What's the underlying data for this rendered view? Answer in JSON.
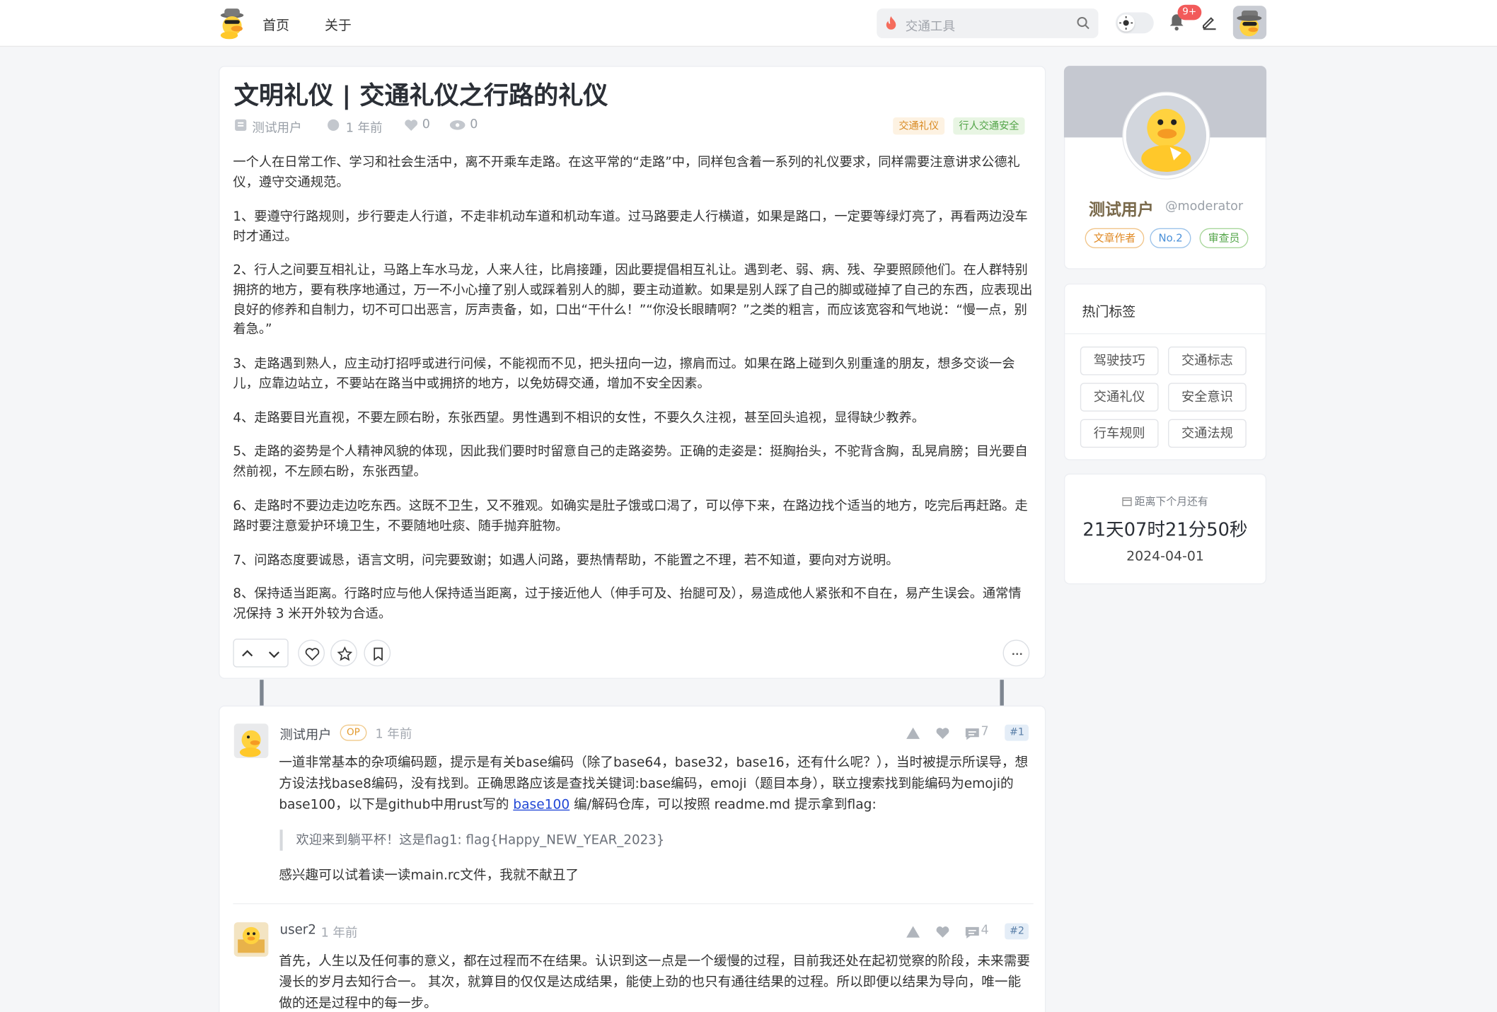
{
  "nav": {
    "home": "首页",
    "about": "关于"
  },
  "search": {
    "placeholder": "交通工具"
  },
  "notifications": {
    "badge": "9+"
  },
  "post": {
    "title": "文明礼仪 | 交通礼仪之行路的礼仪",
    "author": "测试用户",
    "time": "1 年前",
    "likes": "0",
    "views": "0",
    "tags": [
      "交通礼仪",
      "行人交通安全"
    ],
    "paragraphs": [
      "一个人在日常工作、学习和社会生活中，离不开乘车走路。在这平常的“走路”中，同样包含着一系列的礼仪要求，同样需要注意讲求公德礼仪，遵守交通规范。",
      "1、要遵守行路规则，步行要走人行道，不走非机动车道和机动车道。过马路要走人行横道，如果是路口，一定要等绿灯亮了，再看两边没车时才通过。",
      "2、行人之间要互相礼让，马路上车水马龙，人来人往，比肩接踵，因此要提倡相互礼让。遇到老、弱、病、残、孕要照顾他们。在人群特别拥挤的地方，要有秩序地通过，万一不小心撞了别人或踩着别人的脚，要主动道歉。如果是别人踩了自己的脚或碰掉了自己的东西，应表现出良好的修养和自制力，切不可口出恶言，厉声责备，如，口出“干什么！”“你没长眼睛啊？”之类的粗言，而应该宽容和气地说：“慢一点，别着急。”",
      "3、走路遇到熟人，应主动打招呼或进行问候，不能视而不见，把头扭向一边，擦肩而过。如果在路上碰到久别重逢的朋友，想多交谈一会儿，应靠边站立，不要站在路当中或拥挤的地方，以免妨碍交通，增加不安全因素。",
      "4、走路要目光直视，不要左顾右盼，东张西望。男性遇到不相识的女性，不要久久注视，甚至回头追视，显得缺少教养。",
      "5、走路的姿势是个人精神风貌的体现，因此我们要时时留意自己的走路姿势。正确的走姿是：挺胸抬头，不驼背含胸，乱晃肩膀；目光要自然前视，不左顾右盼，东张西望。",
      "6、走路时不要边走边吃东西。这既不卫生，又不雅观。如确实是肚子饿或口渴了，可以停下来，在路边找个适当的地方，吃完后再赶路。走路时要注意爱护环境卫生，不要随地吐痰、随手抛弃脏物。",
      "7、问路态度要诚恳，语言文明，问完要致谢；如遇人问路，要热情帮助，不能置之不理，若不知道，要向对方说明。",
      "8、保持适当距离。行路时应与他人保持适当距离，过于接近他人（伸手可及、抬腿可及），易造成他人紧张和不自在，易产生误会。通常情况保持 3 米开外较为合适。"
    ]
  },
  "comments": [
    {
      "author": "测试用户",
      "op": "OP",
      "time": "1 年前",
      "replies": "7",
      "number": "#1",
      "text_before_link": "一道非常基本的杂项编码题，提示是有关base编码（除了base64，base32，base16，还有什么呢？），当时被提示所误导，想方设法找base8编码，没有找到。正确思路应该是查找关键词:base编码，emoji（题目本身），联立搜索找到能编码为emoji的base100，以下是github中用rust写的 ",
      "link": "base100",
      "text_after_link": " 编/解码仓库，可以按照 readme.md 提示拿到flag:",
      "quote": "欢迎来到躺平杯！这是flag1: flag{Happy_NEW_YEAR_2023}",
      "closing": "感兴趣可以试着读一读main.rc文件，我就不献丑了"
    },
    {
      "author": "user2",
      "time": "1 年前",
      "replies": "4",
      "number": "#2",
      "text": "首先，人生以及任何事的意义，都在过程而不在结果。认识到这一点是一个缓慢的过程，目前我还处在起初觉察的阶段，未来需要漫长的岁月去知行合一。 其次，就算目的仅仅是达成结果，能使上劲的也只有通往结果的过程。所以即便以结果为导向，唯一能做的还是过程中的每一步。"
    }
  ],
  "profile": {
    "name": "测试用户",
    "handle": "@moderator",
    "badges": [
      "文章作者",
      "No.2",
      "审查员"
    ]
  },
  "hot_tags": {
    "heading": "热门标签",
    "items": [
      "驾驶技巧",
      "交通标志",
      "交通礼仪",
      "安全意识",
      "行车规则",
      "交通法规"
    ]
  },
  "countdown": {
    "label": "距离下个月还有",
    "value": "21天07时21分50秒",
    "date": "2024-04-01"
  },
  "colors": {
    "accent": "#2147d6",
    "badge": "#f25a5a",
    "tag_orange": "#e39a2e",
    "tag_green": "#52a447",
    "tag_blue": "#4a90d9"
  }
}
